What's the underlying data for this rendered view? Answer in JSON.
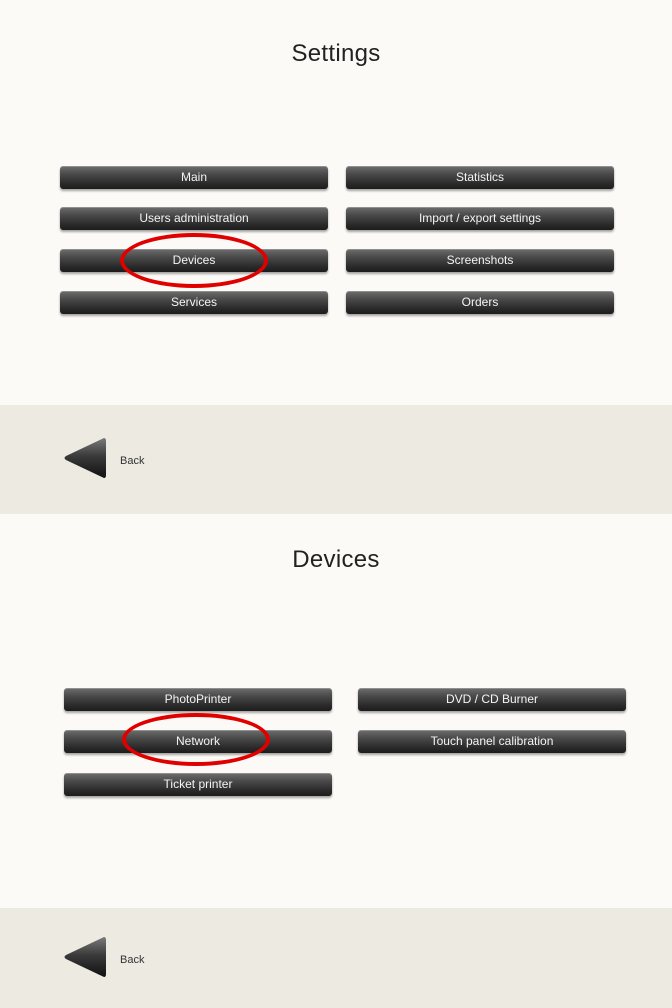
{
  "settings_screen": {
    "title": "Settings",
    "buttons": {
      "main": "Main",
      "statistics": "Statistics",
      "users_administration": "Users administration",
      "import_export": "Import / export settings",
      "devices": "Devices",
      "screenshots": "Screenshots",
      "services": "Services",
      "orders": "Orders"
    },
    "back_label": "Back"
  },
  "devices_screen": {
    "title": "Devices",
    "buttons": {
      "photoprinter": "PhotoPrinter",
      "dvd_cd_burner": "DVD / CD Burner",
      "network": "Network",
      "touch_panel_calibration": "Touch panel calibration",
      "ticket_printer": "Ticket printer"
    },
    "back_label": "Back"
  },
  "colors": {
    "highlight": "#e00000",
    "content_bg": "#fcfaf6",
    "footer_bg": "#edeae2",
    "button_bg": "#2b2b2b"
  },
  "icons": {
    "back": "back-arrow-icon"
  }
}
